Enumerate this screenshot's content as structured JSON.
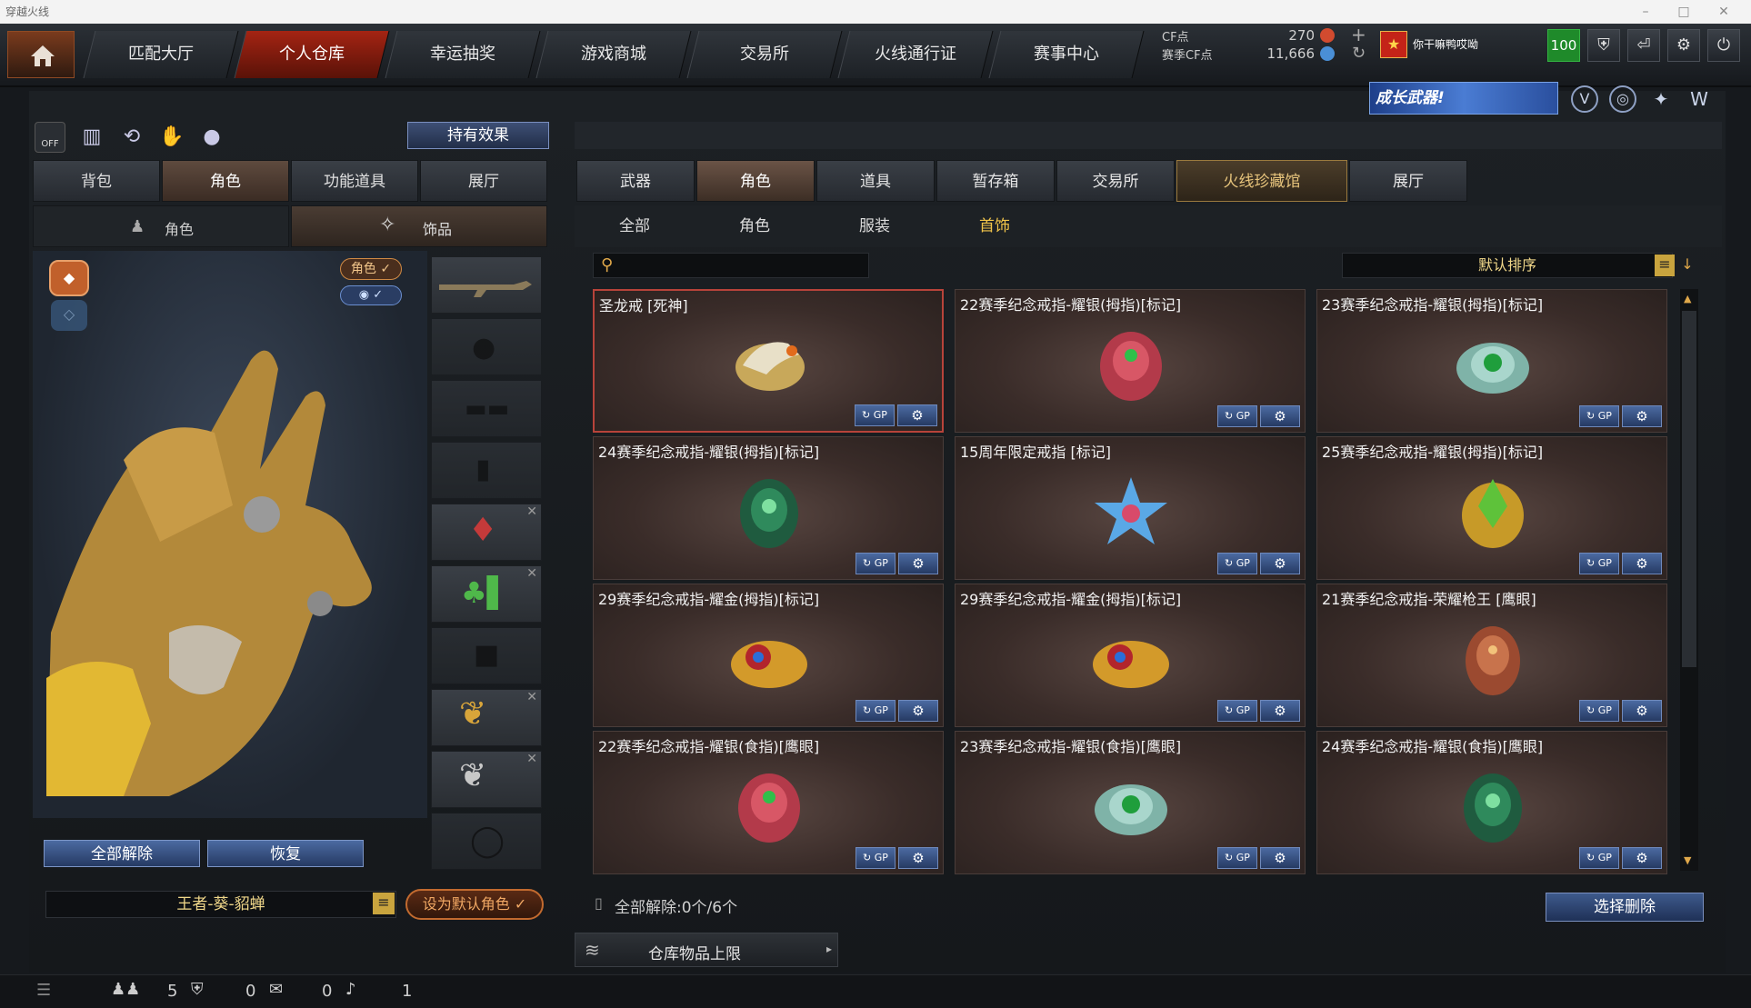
{
  "window": {
    "title": "穿越火线"
  },
  "nav": {
    "tabs": [
      "匹配大厅",
      "个人仓库",
      "幸运抽奖",
      "游戏商城",
      "交易所",
      "火线通行证",
      "赛事中心"
    ],
    "active_index": 1
  },
  "currency": {
    "cf_label": "CF点",
    "cf_value": "270",
    "season_label": "赛季CF点",
    "season_value": "11,666"
  },
  "user": {
    "name": "你干嘛鸭哎呦",
    "level": "100"
  },
  "banner": {
    "text": "成长武器!"
  },
  "left": {
    "hold_effect": "持有效果",
    "tabs": [
      "背包",
      "角色",
      "功能道具",
      "展厅"
    ],
    "active_tab": 1,
    "subtabs": [
      "角色",
      "饰品"
    ],
    "badge_role": "角色 ✓",
    "badge_eye": "✓",
    "unequip_all": "全部解除",
    "restore": "恢复",
    "character_name": "王者-葵-貂蝉",
    "set_default": "设为默认角色 ✓",
    "toggle_off": "OFF"
  },
  "right": {
    "tabs": [
      "武器",
      "角色",
      "道具",
      "暂存箱",
      "交易所",
      "火线珍藏馆",
      "展厅"
    ],
    "active_tab": 1,
    "filters": [
      "全部",
      "角色",
      "服装",
      "首饰"
    ],
    "active_filter": 3,
    "search_placeholder": "",
    "sort_label": "默认排序",
    "items": [
      {
        "name": "圣龙戒 [死神]",
        "ring": "dragon"
      },
      {
        "name": "22赛季纪念戒指-耀银(拇指)[标记]",
        "ring": "red"
      },
      {
        "name": "23赛季纪念戒指-耀银(拇指)[标记]",
        "ring": "greenwolf"
      },
      {
        "name": "24赛季纪念戒指-耀银(拇指)[标记]",
        "ring": "greenlion"
      },
      {
        "name": "15周年限定戒指 [标记]",
        "ring": "star"
      },
      {
        "name": "25赛季纪念戒指-耀银(拇指)[标记]",
        "ring": "gold"
      },
      {
        "name": "29赛季纪念戒指-耀金(拇指)[标记]",
        "ring": "goldwing"
      },
      {
        "name": "29赛季纪念戒指-耀金(拇指)[标记]",
        "ring": "goldwing"
      },
      {
        "name": "21赛季纪念戒指-荣耀枪王 [鹰眼]",
        "ring": "bronze"
      },
      {
        "name": "22赛季纪念戒指-耀银(食指)[鹰眼]",
        "ring": "red"
      },
      {
        "name": "23赛季纪念戒指-耀银(食指)[鹰眼]",
        "ring": "greenwolf"
      },
      {
        "name": "24赛季纪念戒指-耀银(食指)[鹰眼]",
        "ring": "greenlion"
      }
    ],
    "unequip_count": "全部解除:0个/6个",
    "delete_selected": "选择删除",
    "storage_limit": "仓库物品上限",
    "gp_label": "GP"
  },
  "status": {
    "v1": "5",
    "v2": "0",
    "v3": "0",
    "v4": "1"
  }
}
